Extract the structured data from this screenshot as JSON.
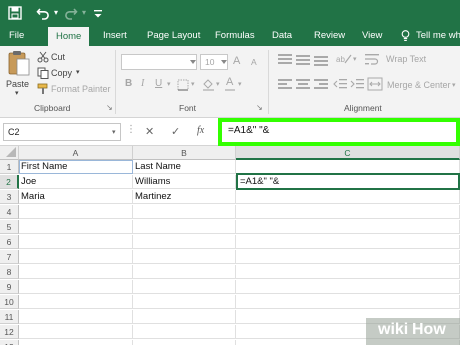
{
  "app": {
    "accent": "#217346",
    "highlight": "#33ff00"
  },
  "quick_access": {
    "save_icon": "save-icon",
    "undo_icon": "undo-icon",
    "redo_icon": "redo-icon",
    "customize_icon": "customize-icon"
  },
  "tabs": [
    "File",
    "Home",
    "Insert",
    "Page Layout",
    "Formulas",
    "Data",
    "Review",
    "View",
    "Tell me wha"
  ],
  "active_tab": "Home",
  "clipboard": {
    "paste": "Paste",
    "cut": "Cut",
    "copy": "Copy",
    "copy_dropdown": "▾",
    "format_painter": "Format Painter",
    "group": "Clipboard"
  },
  "font": {
    "size": "10",
    "bold": "B",
    "italic": "I",
    "underline": "U",
    "grow": "A",
    "shrink": "A",
    "font_color": "A",
    "group": "Font"
  },
  "alignment": {
    "wrap_text": "Wrap Text",
    "merge_center": "Merge & Center",
    "group": "Alignment"
  },
  "formula_bar": {
    "name_box": "C2",
    "cancel": "✕",
    "enter": "✓",
    "fx": "fx",
    "value": "=A1&\" \"&"
  },
  "grid": {
    "columns": [
      "A",
      "B",
      "C"
    ],
    "rows": [
      "1",
      "2",
      "3",
      "4",
      "5",
      "6",
      "7",
      "8",
      "9",
      "10",
      "11",
      "12",
      "13"
    ],
    "cells": {
      "A1": "First Name",
      "B1": "Last Name",
      "A2": "Joe",
      "B2": "Williams",
      "C2": "=A1&\" \"&",
      "A3": "Maria",
      "B3": "Martinez"
    }
  },
  "watermark": {
    "wiki": "wiki",
    "how": "How"
  }
}
